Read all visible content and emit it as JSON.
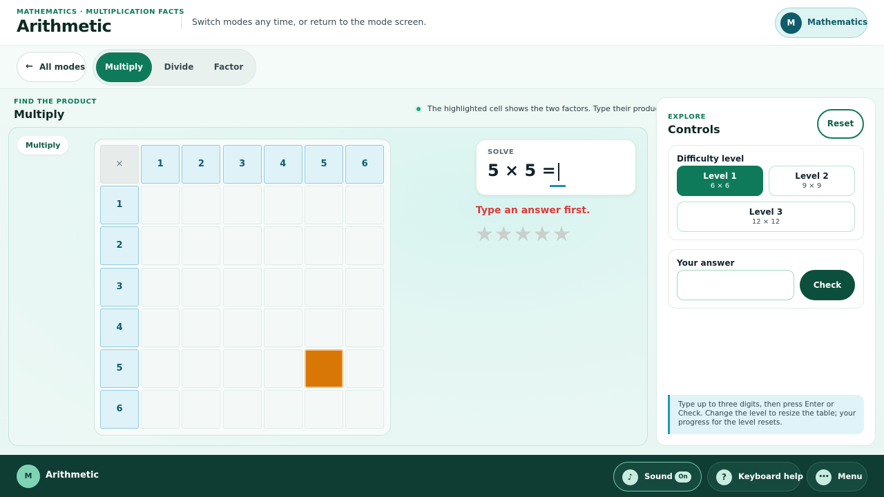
{
  "header": {
    "eyebrow": "MATHEMATICS · MULTIPLICATION FACTS",
    "title": "Arithmetic",
    "subtitle": "Switch modes any time, or return to the mode screen.",
    "subject": {
      "avatar": "M",
      "name": "Mathematics"
    }
  },
  "modebar": {
    "back": {
      "arrow": "←",
      "label": "All modes"
    },
    "modes": [
      "Multiply",
      "Divide",
      "Factor"
    ],
    "active_mode": "Multiply"
  },
  "section": {
    "eyebrow": "FIND THE PRODUCT",
    "title": "Multiply",
    "hint": "The highlighted cell shows the two factors. Type their product."
  },
  "stage": {
    "chip": "Multiply",
    "grid": {
      "corner": "×",
      "columns": [
        "1",
        "2",
        "3",
        "4",
        "5",
        "6"
      ],
      "rows": [
        "1",
        "2",
        "3",
        "4",
        "5",
        "6"
      ],
      "highlight": {
        "row": 5,
        "col": 5
      }
    },
    "solve": {
      "label": "SOLVE",
      "equation": "5 × 5 ="
    },
    "feedback": "Type an answer first.",
    "stars": {
      "earned": 0,
      "total": 5,
      "glyph": "★★★★★"
    }
  },
  "panel": {
    "eyebrow": "EXPLORE",
    "title": "Controls",
    "reset": "Reset",
    "difficulty": {
      "title": "Difficulty level",
      "levels": [
        {
          "name": "Level 1",
          "size": "6 × 6"
        },
        {
          "name": "Level 2",
          "size": "9 × 9"
        },
        {
          "name": "Level 3",
          "size": "12 × 12"
        }
      ],
      "active": "Level 1"
    },
    "answer": {
      "title": "Your answer",
      "value": "",
      "check": "Check"
    },
    "note": "Type up to three digits, then press Enter or Check. Change the level to resize the table; your progress for the level resets."
  },
  "footer": {
    "avatar": "M",
    "title": "Arithmetic",
    "sound": {
      "icon": "♪",
      "label": "Sound",
      "state": "On"
    },
    "keyboard": {
      "icon": "?",
      "label": "Keyboard help"
    },
    "menu": {
      "icon": "•••",
      "label": "Menu"
    }
  },
  "colors": {
    "accent": "#0f7a5a",
    "highlight_cell": "#d97706",
    "error": "#dc3a3a",
    "footer": "#0f3d34"
  }
}
